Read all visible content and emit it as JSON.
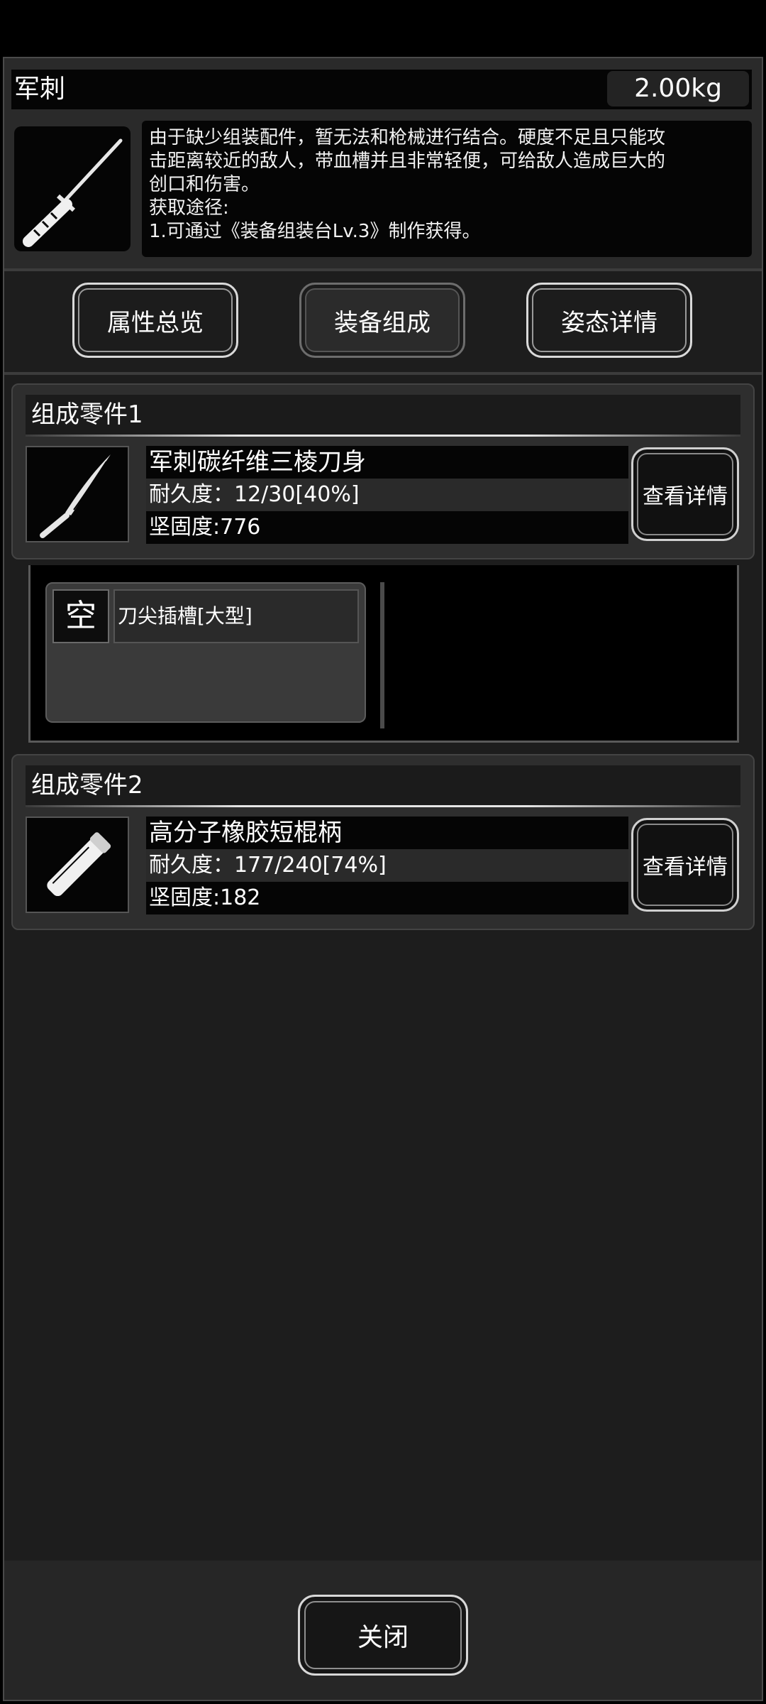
{
  "item": {
    "name": "军刺",
    "weight": "2.00kg",
    "description_lines": [
      "由于缺少组装配件，暂无法和枪械进行结合。硬度不足且只能攻",
      "击距离较近的敌人，带血槽并且非常轻便，可给敌人造成巨大的",
      "创口和伤害。",
      "获取途径:",
      "1.可通过《装备组装台Lv.3》制作获得。"
    ],
    "icon": "bayonet-icon"
  },
  "tabs": [
    {
      "label": "属性总览",
      "active": false
    },
    {
      "label": "装备组成",
      "active": true
    },
    {
      "label": "姿态详情",
      "active": false
    }
  ],
  "parts": [
    {
      "header": "组成零件1",
      "name": "军刺碳纤维三棱刀身",
      "durability": "耐久度：12/30[40%]",
      "hardness": "坚固度:776",
      "detail_label": "查看详情",
      "icon": "blade-icon"
    },
    {
      "header": "组成零件2",
      "name": "高分子橡胶短棍柄",
      "durability": "耐久度：177/240[74%]",
      "hardness": "坚固度:182",
      "detail_label": "查看详情",
      "icon": "handle-icon"
    }
  ],
  "slot": {
    "status": "空",
    "label": "刀尖插槽[大型]"
  },
  "close_label": "关闭"
}
